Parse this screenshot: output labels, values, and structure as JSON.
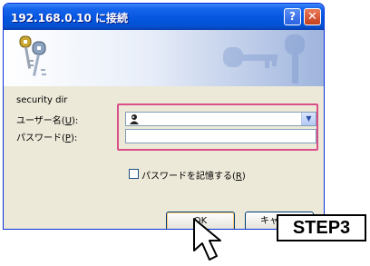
{
  "window": {
    "title": "192.168.0.10 に接続",
    "help_glyph": "?",
    "close_glyph": "✕"
  },
  "form": {
    "realm": "security dir",
    "username_label": "ユーザー名(",
    "username_accel": "U",
    "username_label_end": "):",
    "password_label": "パスワード(",
    "password_accel": "P",
    "password_label_end": "):",
    "username_value": "",
    "remember_label": "パスワードを記憶する(",
    "remember_accel": "R",
    "remember_end": ")",
    "remember_checked": false
  },
  "buttons": {
    "ok": "OK",
    "cancel": "キャンセル"
  },
  "annotation": {
    "step": "STEP3",
    "highlight_color": "#d94f89"
  },
  "icons": [
    "keys-icon",
    "help-icon",
    "close-icon",
    "user-icon",
    "dropdown-arrow-icon",
    "mouse-pointer-icon"
  ]
}
